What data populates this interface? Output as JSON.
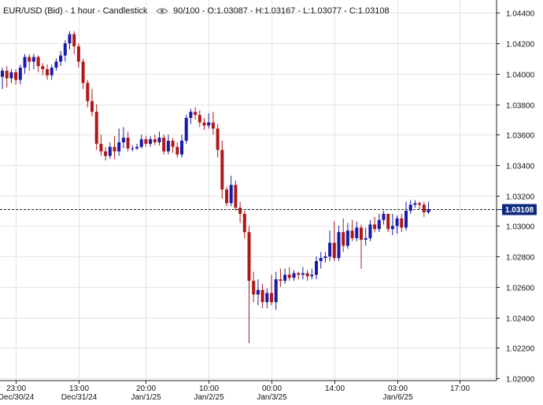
{
  "header": {
    "symbol": "EUR/USD (Bid)",
    "interval": "1 hour",
    "style": "Candlestick",
    "range": "90/100",
    "open_label": "O:1.03087",
    "high_label": "H:1.03167",
    "low_label": "L:1.03077",
    "close_label": "C:1.03108",
    "icon": "eye-icon"
  },
  "last_price": {
    "label": "1.03108",
    "value": 1.03108
  },
  "colors": {
    "up": "#1a1aa8",
    "down": "#b01818",
    "grid": "#e4e4e4",
    "axis": "#222222",
    "price_tag_bg": "#0d2a80",
    "price_tag_fg": "#ffffff"
  },
  "chart_data": {
    "type": "candlestick",
    "x_ticks": [
      {
        "index": 3,
        "time": "23:00",
        "date": "Dec/30/24"
      },
      {
        "index": 17,
        "time": "13:00",
        "date": "Dec/31/24"
      },
      {
        "index": 32,
        "time": "20:00",
        "date": "Jan/1/25"
      },
      {
        "index": 46,
        "time": "10:00",
        "date": "Jan/2/25"
      },
      {
        "index": 60,
        "time": "00:00",
        "date": "Jan/3/25"
      },
      {
        "index": 74,
        "time": "14:00",
        "date": ""
      },
      {
        "index": 88,
        "time": "03:00",
        "date": "Jan/6/25"
      },
      {
        "index": 102,
        "time": "17:00",
        "date": ""
      }
    ],
    "y_ticks": [
      1.044,
      1.042,
      1.04,
      1.038,
      1.036,
      1.034,
      1.032,
      1.03,
      1.028,
      1.026,
      1.024,
      1.022,
      1.02
    ],
    "y_tick_labels": [
      "1.04400",
      "1.04200",
      "1.04000",
      "1.03800",
      "1.03600",
      "1.03400",
      "1.03200",
      "1.03000",
      "1.02800",
      "1.02600",
      "1.02400",
      "1.02200",
      "1.02000"
    ],
    "ylim": [
      1.02,
      1.045
    ],
    "bar_count": 110,
    "grid": true,
    "candles": [
      [
        1.0398,
        1.0402,
        1.039,
        1.0404
      ],
      [
        1.0402,
        1.0397,
        1.0391,
        1.0405
      ],
      [
        1.0397,
        1.0401,
        1.0394,
        1.0403
      ],
      [
        1.0401,
        1.0396,
        1.0393,
        1.0403
      ],
      [
        1.0396,
        1.0404,
        1.0393,
        1.0406
      ],
      [
        1.0404,
        1.0411,
        1.04,
        1.0413
      ],
      [
        1.0411,
        1.0408,
        1.0402,
        1.0413
      ],
      [
        1.0408,
        1.0411,
        1.0403,
        1.0413
      ],
      [
        1.0411,
        1.0405,
        1.0401,
        1.0412
      ],
      [
        1.0405,
        1.0403,
        1.0399,
        1.0407
      ],
      [
        1.0403,
        1.0399,
        1.0396,
        1.0406
      ],
      [
        1.0399,
        1.0404,
        1.0396,
        1.0406
      ],
      [
        1.0404,
        1.0408,
        1.0402,
        1.041
      ],
      [
        1.0408,
        1.0412,
        1.0405,
        1.0415
      ],
      [
        1.0412,
        1.042,
        1.0408,
        1.0422
      ],
      [
        1.042,
        1.0426,
        1.0416,
        1.0428
      ],
      [
        1.0426,
        1.0418,
        1.0413,
        1.0428
      ],
      [
        1.0418,
        1.0408,
        1.0404,
        1.042
      ],
      [
        1.0408,
        1.0394,
        1.039,
        1.041
      ],
      [
        1.0394,
        1.0382,
        1.0378,
        1.0396
      ],
      [
        1.0382,
        1.0375,
        1.0372,
        1.039
      ],
      [
        1.0375,
        1.0354,
        1.035,
        1.038
      ],
      [
        1.0354,
        1.0349,
        1.0346,
        1.036
      ],
      [
        1.0349,
        1.0346,
        1.0343,
        1.0352
      ],
      [
        1.0346,
        1.0352,
        1.0344,
        1.0355
      ],
      [
        1.0352,
        1.0349,
        1.0344,
        1.0359
      ],
      [
        1.0349,
        1.0355,
        1.0346,
        1.0364
      ],
      [
        1.0355,
        1.0358,
        1.0351,
        1.0365
      ],
      [
        1.0358,
        1.0351,
        1.0349,
        1.0362
      ],
      [
        1.0351,
        1.0351,
        1.0349,
        1.0353
      ],
      [
        1.0351,
        1.0352,
        1.035,
        1.0354
      ],
      [
        1.0352,
        1.0357,
        1.0351,
        1.036
      ],
      [
        1.0357,
        1.0354,
        1.0352,
        1.0359
      ],
      [
        1.0354,
        1.0357,
        1.0352,
        1.0359
      ],
      [
        1.0357,
        1.0355,
        1.0353,
        1.036
      ],
      [
        1.0355,
        1.0358,
        1.0353,
        1.0362
      ],
      [
        1.0358,
        1.0349,
        1.0347,
        1.036
      ],
      [
        1.0349,
        1.0356,
        1.0347,
        1.036
      ],
      [
        1.0356,
        1.0352,
        1.0348,
        1.0358
      ],
      [
        1.0352,
        1.0347,
        1.0345,
        1.0355
      ],
      [
        1.0347,
        1.0356,
        1.0345,
        1.036
      ],
      [
        1.0356,
        1.0371,
        1.0354,
        1.0373
      ],
      [
        1.0371,
        1.0375,
        1.0367,
        1.0377
      ],
      [
        1.0375,
        1.0373,
        1.037,
        1.0378
      ],
      [
        1.0373,
        1.0368,
        1.0365,
        1.0376
      ],
      [
        1.0368,
        1.0366,
        1.0363,
        1.0371
      ],
      [
        1.0366,
        1.0368,
        1.0364,
        1.0374
      ],
      [
        1.0368,
        1.0364,
        1.036,
        1.0375
      ],
      [
        1.0364,
        1.035,
        1.0345,
        1.0367
      ],
      [
        1.035,
        1.0324,
        1.0318,
        1.0356
      ],
      [
        1.0324,
        1.0315,
        1.0313,
        1.0326
      ],
      [
        1.0315,
        1.0327,
        1.0313,
        1.0333
      ],
      [
        1.0327,
        1.0312,
        1.031,
        1.033
      ],
      [
        1.0312,
        1.0308,
        1.0302,
        1.0316
      ],
      [
        1.0308,
        1.0296,
        1.0292,
        1.031
      ],
      [
        1.0296,
        1.0264,
        1.0223,
        1.03
      ],
      [
        1.0264,
        1.0255,
        1.025,
        1.027
      ],
      [
        1.0255,
        1.0258,
        1.0248,
        1.0265
      ],
      [
        1.0258,
        1.025,
        1.0246,
        1.0262
      ],
      [
        1.025,
        1.0256,
        1.0246,
        1.0259
      ],
      [
        1.0256,
        1.025,
        1.0248,
        1.0268
      ],
      [
        1.025,
        1.0265,
        1.0245,
        1.027
      ],
      [
        1.0265,
        1.0264,
        1.026,
        1.0272
      ],
      [
        1.0264,
        1.0268,
        1.0262,
        1.0272
      ],
      [
        1.0268,
        1.0266,
        1.0264,
        1.0273
      ],
      [
        1.0266,
        1.0269,
        1.0264,
        1.0271
      ],
      [
        1.0269,
        1.0268,
        1.0265,
        1.027
      ],
      [
        1.0268,
        1.0269,
        1.0265,
        1.0273
      ],
      [
        1.0269,
        1.0267,
        1.0264,
        1.0271
      ],
      [
        1.0267,
        1.0268,
        1.0265,
        1.0272
      ],
      [
        1.0268,
        1.0277,
        1.0265,
        1.028
      ],
      [
        1.0277,
        1.0279,
        1.0272,
        1.0283
      ],
      [
        1.0279,
        1.028,
        1.0276,
        1.0283
      ],
      [
        1.028,
        1.0289,
        1.0277,
        1.0297
      ],
      [
        1.0289,
        1.0279,
        1.0277,
        1.0303
      ],
      [
        1.0279,
        1.0296,
        1.0277,
        1.03
      ],
      [
        1.0296,
        1.0287,
        1.0283,
        1.0305
      ],
      [
        1.0287,
        1.0297,
        1.0285,
        1.0302
      ],
      [
        1.0297,
        1.0292,
        1.029,
        1.0304
      ],
      [
        1.0292,
        1.0299,
        1.029,
        1.0303
      ],
      [
        1.0299,
        1.0291,
        1.0272,
        1.0301
      ],
      [
        1.0291,
        1.0292,
        1.0287,
        1.0299
      ],
      [
        1.0292,
        1.0301,
        1.029,
        1.0304
      ],
      [
        1.0301,
        1.0298,
        1.0296,
        1.0306
      ],
      [
        1.0298,
        1.0304,
        1.0296,
        1.0308
      ],
      [
        1.0304,
        1.0308,
        1.0301,
        1.031
      ],
      [
        1.0308,
        1.0298,
        1.0296,
        1.0308
      ],
      [
        1.0298,
        1.03,
        1.0294,
        1.0308
      ],
      [
        1.03,
        1.0305,
        1.0295,
        1.0307
      ],
      [
        1.0305,
        1.0299,
        1.0296,
        1.0308
      ],
      [
        1.0299,
        1.031,
        1.0297,
        1.0316
      ],
      [
        1.031,
        1.0314,
        1.0308,
        1.0317
      ],
      [
        1.0314,
        1.0315,
        1.0312,
        1.0317
      ],
      [
        1.0315,
        1.0314,
        1.0311,
        1.0316
      ],
      [
        1.0314,
        1.0309,
        1.0306,
        1.0316
      ],
      [
        1.0309,
        1.0311,
        1.0308,
        1.0316
      ]
    ]
  }
}
